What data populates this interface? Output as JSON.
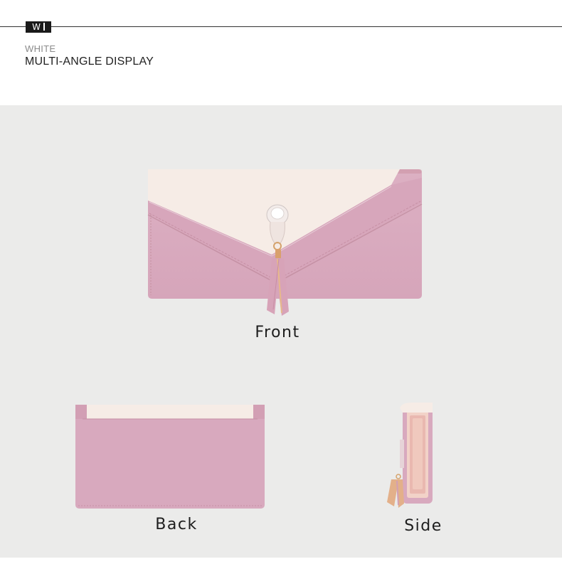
{
  "header": {
    "badge": "W",
    "color_name": "WHITE",
    "section_title": "MULTI-ANGLE DISPLAY"
  },
  "views": {
    "front_label": "Front",
    "back_label": "Back",
    "side_label": "Side"
  },
  "colors": {
    "background_panel": "#ebebea",
    "wallet_pink": "#d8a9be",
    "flap_cream": "#f6ebe5",
    "tassel_tan": "#d9a06c"
  }
}
